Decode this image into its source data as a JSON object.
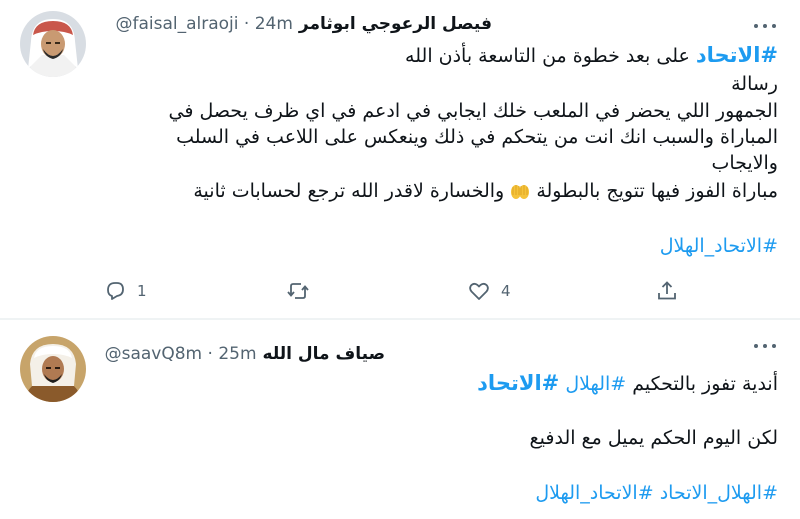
{
  "tweets": [
    {
      "display_name": "فيصل الرعوجي ابوثامر",
      "handle": "@faisal_alraoji",
      "dot": "·",
      "time": "24m",
      "lines": {
        "l1_tag": "#الاتحاد",
        "l1_text": "على بعد خطوة من التاسعة بأذن الله",
        "l2": "رسالة",
        "l3": "الجمهور اللي يحضر في الملعب خلك ايجابي في ادعم في اي ظرف يحصل في",
        "l4": "المباراة والسبب انك انت من يتحكم في ذلك وينعكس على اللاعب في السلب",
        "l5": "والايجاب",
        "l6a": "مباراة الفوز فيها تتويج بالبطولة",
        "l6b": "والخسارة لاقدر الله ترجع لحسابات ثانية",
        "l7_tag": "#الاتحاد_الهلال"
      },
      "reply_count": "1",
      "like_count": "4"
    },
    {
      "display_name": "صياف مال الله",
      "handle": "@saavQ8m",
      "dot": "·",
      "time": "25m",
      "lines": {
        "l1_text": "أندية تفوز بالتحكيم",
        "l1_tag1": "#الهلال",
        "l1_tag2": "#الاتحاد",
        "l2": "لكن اليوم الحكم يميل مع الدفيع",
        "l3_tag1": "#الهلال_الاتحاد",
        "l3_tag2": "#الاتحاد_الهلال"
      }
    }
  ],
  "icons": {
    "more": "more-dots-icon",
    "reply": "reply-icon",
    "retweet": "retweet-icon",
    "like": "like-icon",
    "share": "share-icon",
    "emoji": "raising-hands-emoji-icon"
  },
  "colors": {
    "link": "#1d9bf0",
    "text": "#0f1419",
    "muted": "#536471",
    "divider": "#eff3f4"
  }
}
